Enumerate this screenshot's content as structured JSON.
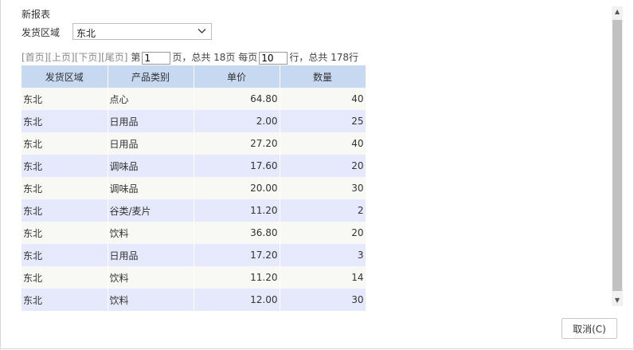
{
  "report": {
    "title": "新报表",
    "filter_label": "发货区域",
    "filter_value": "东北"
  },
  "pager": {
    "first": "[首页]",
    "prev": "[上页]",
    "next": "[下页]",
    "last": "[尾页]",
    "page_prefix": "第",
    "current_page": "1",
    "page_suffix": "页，总共 18页 每页",
    "page_size": "10",
    "rows_suffix": "行，总共 178行"
  },
  "table": {
    "headers": [
      "发货区域",
      "产品类别",
      "单价",
      "数量"
    ],
    "rows": [
      [
        "东北",
        "点心",
        "64.80",
        "40"
      ],
      [
        "东北",
        "日用品",
        "2.00",
        "25"
      ],
      [
        "东北",
        "日用品",
        "27.20",
        "40"
      ],
      [
        "东北",
        "调味品",
        "17.60",
        "20"
      ],
      [
        "东北",
        "调味品",
        "20.00",
        "30"
      ],
      [
        "东北",
        "谷类/麦片",
        "11.20",
        "2"
      ],
      [
        "东北",
        "饮料",
        "36.80",
        "20"
      ],
      [
        "东北",
        "日用品",
        "17.20",
        "3"
      ],
      [
        "东北",
        "饮料",
        "11.20",
        "14"
      ],
      [
        "东北",
        "饮料",
        "12.00",
        "30"
      ]
    ]
  },
  "footer": {
    "cancel_label": "取消(C)"
  },
  "icons": {
    "dropdown": "chevron-down-icon",
    "scroll_up": "scroll-up-arrow-icon",
    "scroll_down": "scroll-down-arrow-icon"
  },
  "colors": {
    "header_bg": "#c6d9f1",
    "row_odd_bg": "#f8f8f4",
    "row_even_bg": "#e6e8fb"
  }
}
